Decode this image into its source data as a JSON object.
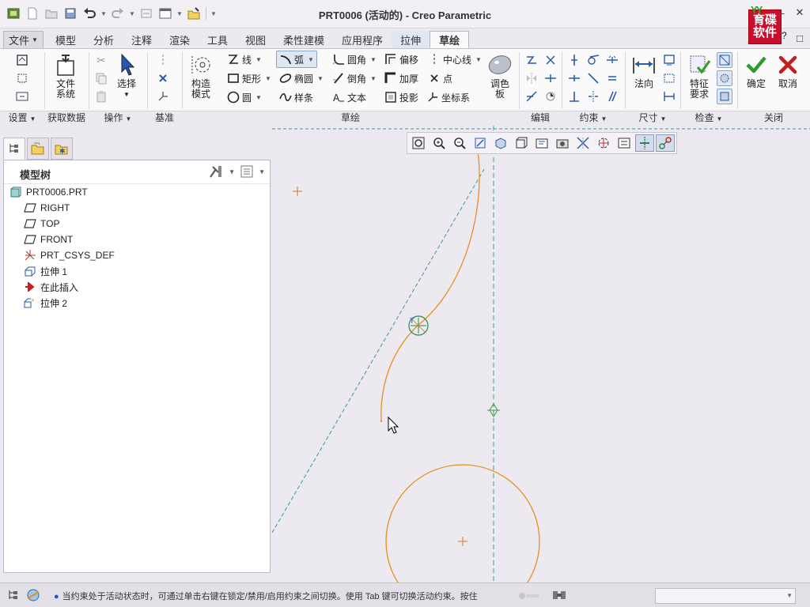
{
  "window": {
    "title": "PRT0006 (活动的) - Creo Parametric",
    "logo_text": [
      "育碟",
      "软件"
    ]
  },
  "tabs": {
    "file": "文件",
    "items": [
      "模型",
      "分析",
      "注释",
      "渲染",
      "工具",
      "视图",
      "柔性建模",
      "应用程序"
    ],
    "context": "拉伸",
    "active": "草绘"
  },
  "ribbon": {
    "groups": {
      "setup": "设置",
      "get_data": "获取数据",
      "operations": "操作",
      "datum": "基准",
      "sketch": "草绘",
      "editing": "编辑",
      "constrain": "约束",
      "dimension": "尺寸",
      "inspect": "检查",
      "close": "关闭"
    },
    "buttons": {
      "file_system_1": "文件",
      "file_system_2": "系统",
      "select": "选择",
      "construction_1": "构造",
      "construction_2": "模式",
      "line": "线",
      "arc": "弧",
      "fillet": "圆角",
      "offset": "偏移",
      "centerline": "中心线",
      "rectangle": "矩形",
      "ellipse": "椭圆",
      "chamfer": "倒角",
      "thicken": "加厚",
      "point": "点",
      "circle": "圆",
      "spline": "样条",
      "text": "文本",
      "project": "投影",
      "csys": "坐标系",
      "palette_1": "调色",
      "palette_2": "板",
      "normal": "法向",
      "feature_req_1": "特征",
      "feature_req_2": "要求",
      "ok": "确定",
      "cancel": "取消"
    }
  },
  "model_tree": {
    "title": "模型树",
    "items": [
      {
        "label": "PRT0006.PRT",
        "icon": "part-icon"
      },
      {
        "label": "RIGHT",
        "icon": "datum-plane-icon"
      },
      {
        "label": "TOP",
        "icon": "datum-plane-icon"
      },
      {
        "label": "FRONT",
        "icon": "datum-plane-icon"
      },
      {
        "label": "PRT_CSYS_DEF",
        "icon": "csys-icon"
      },
      {
        "label": "拉伸 1",
        "icon": "extrude-icon"
      },
      {
        "label": "在此插入",
        "icon": "insert-here-icon"
      },
      {
        "label": "拉伸 2",
        "icon": "extrude-active-icon"
      }
    ]
  },
  "status": {
    "message": "当约束处于活动状态时，可通过单击右键在锁定/禁用/启用约束之间切换。使用 Tab 键可切换活动约束。按住"
  },
  "colors": {
    "sketch_geometry": "#e8901e",
    "centerline": "#3a9a9a",
    "point_marker": "#d07a20",
    "ok_green": "#2f9a2f",
    "cancel_red": "#c02020",
    "tab_highlight": "#dde8f4"
  }
}
